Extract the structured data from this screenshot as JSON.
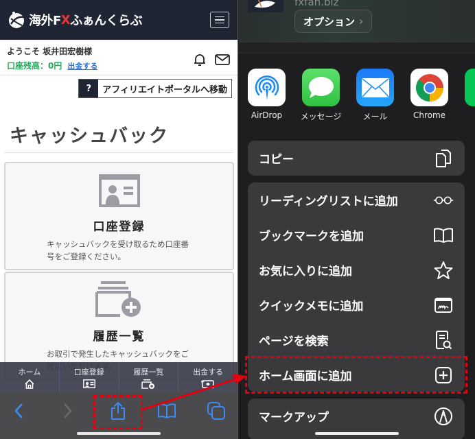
{
  "left": {
    "site": {
      "logo_text_prefix": "海外F",
      "logo_text_x": "X",
      "logo_text_suffix": "ふぁんくらぶ"
    },
    "user": {
      "welcome": "ようこそ 坂井田宏樹様",
      "balance": "口座残高：0円",
      "withdraw_link": "出金する"
    },
    "affiliate": {
      "help": "?",
      "label": "アフィリエイトポータルへ移動"
    },
    "page_title": "キャッシュバック",
    "cards": [
      {
        "title": "口座登録",
        "desc": "キャッシュバックを受け取るため口座番号をご登録ください。"
      },
      {
        "title": "履歴一覧",
        "desc": "お取引で発生したキャッシュバックをご確認いただけます。"
      }
    ],
    "bottom_nav": [
      {
        "label": "ホーム",
        "icon": "home-icon"
      },
      {
        "label": "口座登録",
        "icon": "id-card-icon"
      },
      {
        "label": "履歴一覧",
        "icon": "history-add-icon"
      },
      {
        "label": "出金する",
        "icon": "withdraw-icon"
      }
    ],
    "safari_toolbar": [
      "back-icon",
      "forward-icon",
      "share-icon",
      "bookmarks-icon",
      "tabs-icon"
    ]
  },
  "right": {
    "site_url": "fxfan.biz",
    "options_label": "オプション",
    "apps": [
      {
        "label": "AirDrop",
        "icon": "airdrop-icon"
      },
      {
        "label": "メッセージ",
        "icon": "messages-icon"
      },
      {
        "label": "メール",
        "icon": "mail-icon"
      },
      {
        "label": "Chrome",
        "icon": "chrome-icon"
      }
    ],
    "actions": {
      "copy": {
        "label": "コピー",
        "icon": "copy-icon"
      },
      "main": [
        {
          "label": "リーディングリストに追加",
          "icon": "glasses-icon"
        },
        {
          "label": "ブックマークを追加",
          "icon": "book-icon"
        },
        {
          "label": "お気に入りに追加",
          "icon": "star-icon"
        },
        {
          "label": "クイックメモに追加",
          "icon": "quick-note-icon"
        },
        {
          "label": "ページを検索",
          "icon": "find-in-page-icon"
        },
        {
          "label": "ホーム画面に追加",
          "icon": "add-square-icon"
        }
      ],
      "markup": {
        "label": "マークアップ",
        "icon": "markup-icon"
      }
    }
  },
  "annotation": {
    "color": "#e4000f"
  }
}
